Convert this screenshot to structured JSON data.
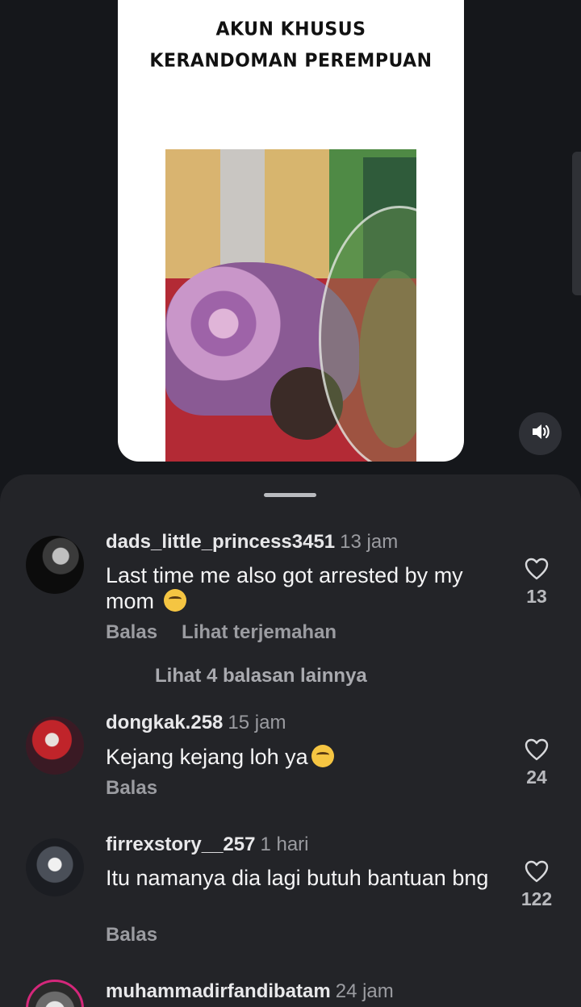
{
  "video": {
    "caption_line1": "AKUN KHUSUS",
    "caption_line2": "KERANDOMAN PEREMPUAN",
    "sound_icon": "speaker-volume-icon"
  },
  "comments": [
    {
      "username": "dads_little_princess3451",
      "time": "13 jam",
      "text": "Last time me also got arrested by my mom",
      "emoji": "crying-face",
      "likes": "13",
      "reply_label": "Balas",
      "translate_label": "Lihat terjemahan",
      "more_replies": "Lihat 4 balasan lainnya"
    },
    {
      "username": "dongkak.258",
      "time": "15 jam",
      "text": "Kejang kejang loh ya",
      "emoji": "laughing-tears",
      "likes": "24",
      "reply_label": "Balas"
    },
    {
      "username": "firrexstory__257",
      "time": "1 hari",
      "text": "Itu namanya dia lagi butuh bantuan bng",
      "likes": "122",
      "reply_label": "Balas"
    },
    {
      "username": "muhammadirfandibatam",
      "time": "24 jam"
    }
  ],
  "colors": {
    "background": "#15171b",
    "sheet": "#232428",
    "muted_text": "#9b9ca1"
  }
}
